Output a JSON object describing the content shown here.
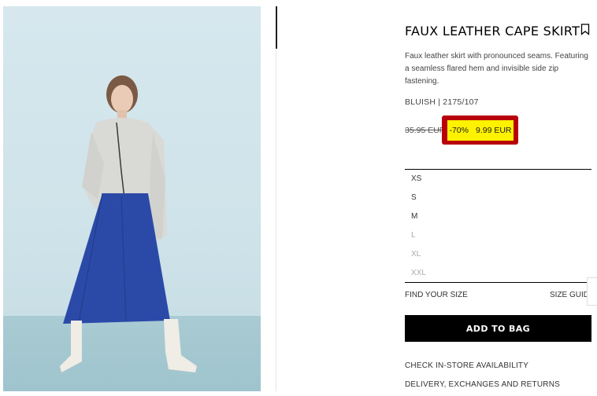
{
  "product": {
    "title": "FAUX LEATHER CAPE SKIRT",
    "description": "Faux leather skirt with pronounced seams. Featuring a seamless flared hem and invisible side zip fastening.",
    "reference": "BLUISH | 2175/107",
    "old_price": "35.95 EUR",
    "discount": "-70%",
    "sale_price": "9.99 EUR"
  },
  "sizes": [
    {
      "label": "XS",
      "available": true
    },
    {
      "label": "S",
      "available": true
    },
    {
      "label": "M",
      "available": true
    },
    {
      "label": "L",
      "available": false
    },
    {
      "label": "XL",
      "available": false
    },
    {
      "label": "XXL",
      "available": false
    }
  ],
  "size_help": {
    "find_your_size": "FIND YOUR SIZE",
    "size_guide": "SIZE GUID"
  },
  "actions": {
    "add_to_bag": "ADD TO BAG",
    "check_store": "CHECK IN-STORE AVAILABILITY",
    "delivery": "DELIVERY, EXCHANGES AND RETURNS"
  },
  "colors": {
    "promo_border": "#b8000b",
    "promo_highlight": "#fff200",
    "button": "#000000",
    "skirt": "#2b4aa8"
  },
  "icons": {
    "bookmark": "bookmark-icon"
  }
}
